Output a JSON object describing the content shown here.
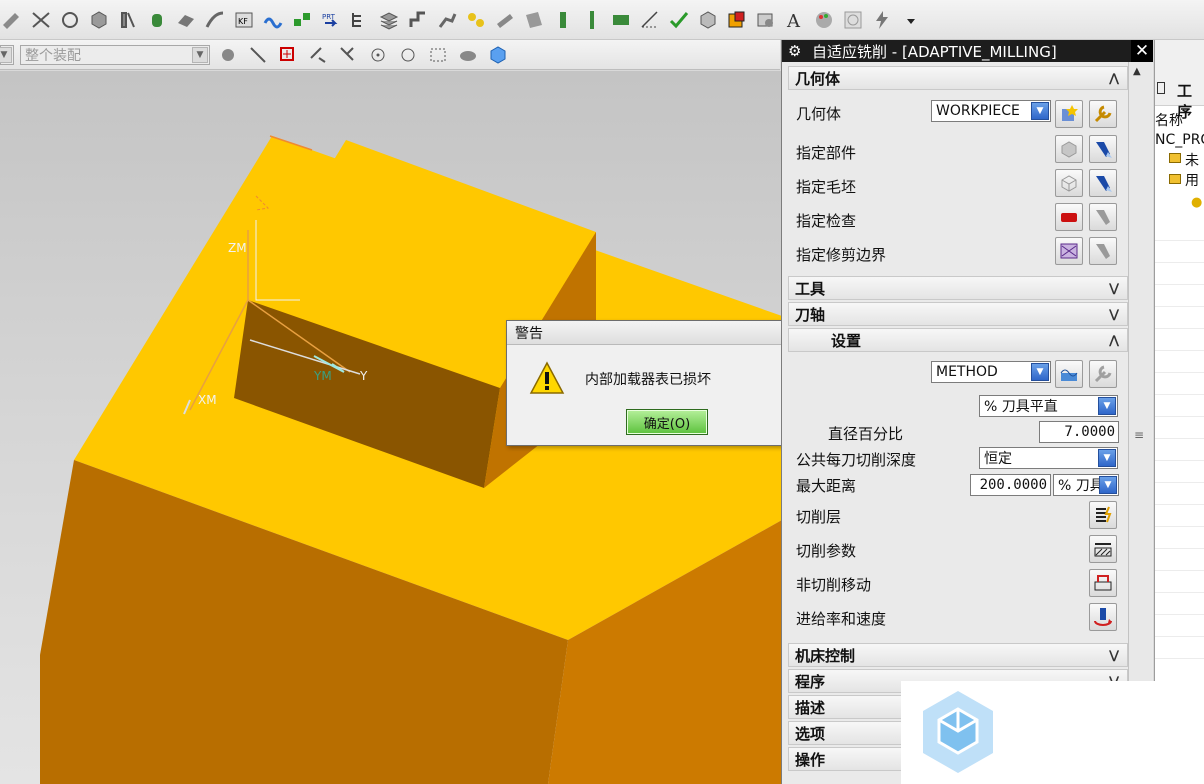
{
  "toolbar2": {
    "assembly_select": "整个装配"
  },
  "viewport": {
    "axis_labels": {
      "zm": "ZM",
      "xm": "XM",
      "ym": "YM",
      "y": "Y"
    },
    "colors": {
      "top_face": "#FFC800",
      "side_left": "#B86E00",
      "side_right": "#CC7A00",
      "background": "#D0D0D0"
    }
  },
  "warning_dialog": {
    "title": "警告",
    "icon": "warning-triangle-icon",
    "message": "内部加载器表已损坏",
    "ok_label": "确定(O)"
  },
  "operation_panel": {
    "title": "自适应铣削 - [ADAPTIVE_MILLING]",
    "sections": {
      "geometry": "几何体",
      "tool": "工具",
      "tool_axis": "刀轴",
      "path_settings": "设置",
      "machine_control": "机床控制",
      "program": "程序",
      "description": "描述",
      "options": "选项",
      "actions": "操作"
    },
    "geometry": {
      "geometry_label": "几何体",
      "geometry_value": "WORKPIECE",
      "specify_part": "指定部件",
      "specify_blank": "指定毛坯",
      "specify_check": "指定检查",
      "specify_trim": "指定修剪边界"
    },
    "path": {
      "method_value": "METHOD",
      "stepover_type": "% 刀具平直",
      "stepover_label": "直径百分比",
      "stepover_value": "7.0000",
      "depth_label": "公共每刀切削深度",
      "depth_value": "恒定",
      "max_distance_label": "最大距离",
      "max_distance_value": "200.0000",
      "max_distance_unit": "% 刀具",
      "cut_levels": "切削层",
      "cut_params": "切削参数",
      "non_cut_moves": "非切削移动",
      "feeds_speeds": "进给率和速度"
    }
  },
  "navigator": {
    "title": "工序",
    "column": "名称",
    "root": "NC_PRO",
    "item1": "未用"
  }
}
